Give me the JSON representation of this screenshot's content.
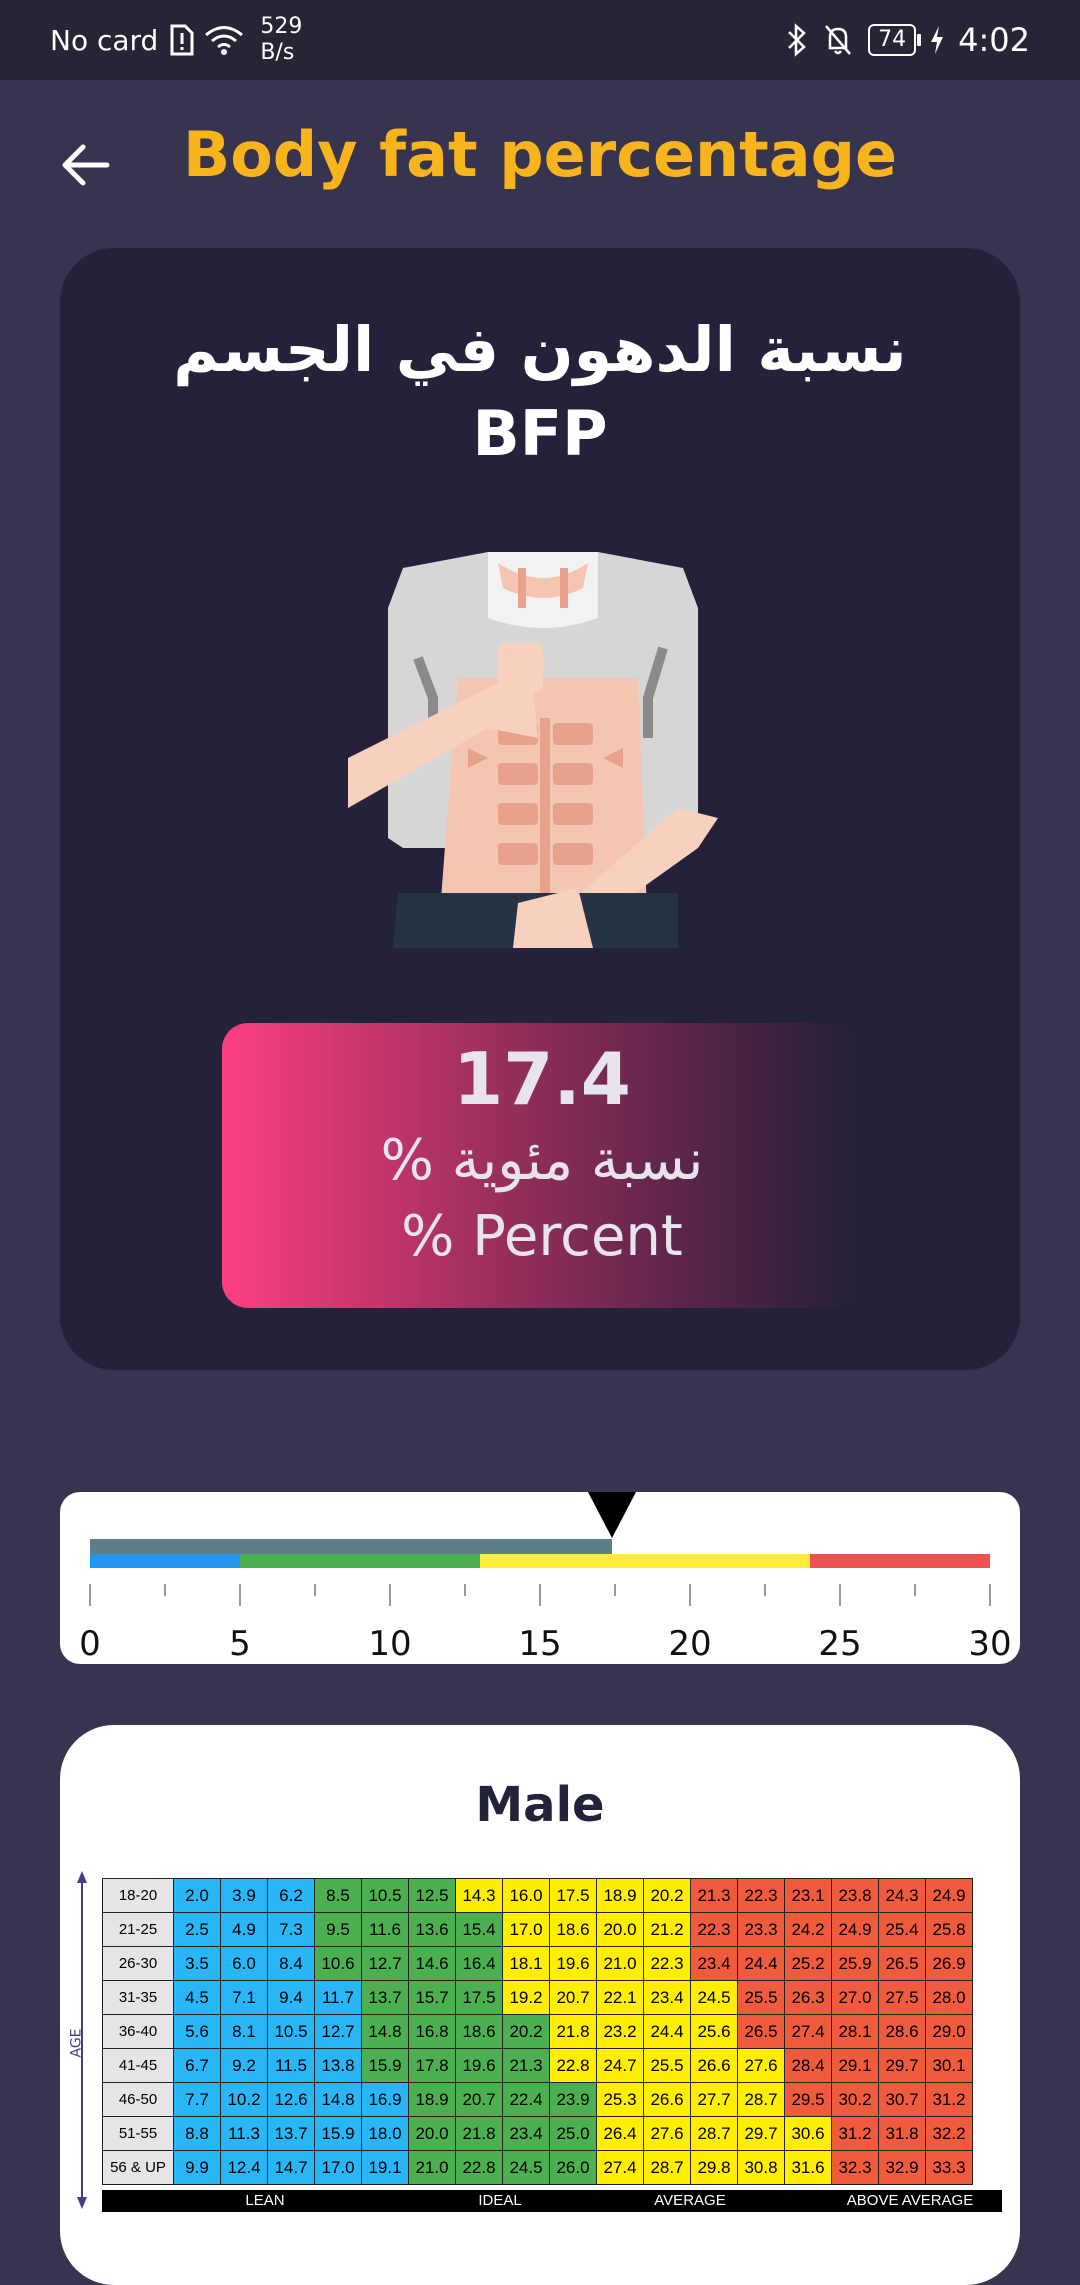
{
  "status_bar": {
    "carrier": "No card",
    "speed_value": "529",
    "speed_unit": "B/s",
    "battery": "74",
    "time": "4:02"
  },
  "header": {
    "title": "Body fat percentage",
    "back_icon": "arrow-left-icon"
  },
  "card": {
    "title_ar": "نسبة الدهون في الجسم",
    "title_en": "BFP",
    "illustration": "abs-torso-illustration"
  },
  "result": {
    "value": "17.4",
    "label_ar": "نسبة مئوية %",
    "label_en": "% Percent"
  },
  "gauge": {
    "value": 17.4,
    "min": 0,
    "max": 30,
    "ticks": [
      "0",
      "5",
      "10",
      "15",
      "20",
      "25",
      "30"
    ],
    "segments": [
      {
        "from": 0,
        "to": 5,
        "color": "#2196f3"
      },
      {
        "from": 5,
        "to": 13,
        "color": "#4caf50"
      },
      {
        "from": 13,
        "to": 24,
        "color": "#ffeb3b"
      },
      {
        "from": 24,
        "to": 30,
        "color": "#ef5350"
      }
    ],
    "fill_color": "#5d7e86"
  },
  "male_chart": {
    "title": "Male",
    "axis_label": "AGE",
    "categories": [
      "LEAN",
      "IDEAL",
      "AVERAGE",
      "ABOVE AVERAGE"
    ],
    "colors": {
      "lean": "#29b6f6",
      "ideal": "#4caf50",
      "average": "#ffee00",
      "above": "#ef5b3c"
    },
    "rows": [
      {
        "age": "18-20",
        "values": [
          "2.0",
          "3.9",
          "6.2",
          "8.5",
          "10.5",
          "12.5",
          "14.3",
          "16.0",
          "17.5",
          "18.9",
          "20.2",
          "21.3",
          "22.3",
          "23.1",
          "23.8",
          "24.3",
          "24.9"
        ],
        "bounds": [
          3,
          6,
          11
        ]
      },
      {
        "age": "21-25",
        "values": [
          "2.5",
          "4.9",
          "7.3",
          "9.5",
          "11.6",
          "13.6",
          "15.4",
          "17.0",
          "18.6",
          "20.0",
          "21.2",
          "22.3",
          "23.3",
          "24.2",
          "24.9",
          "25.4",
          "25.8"
        ],
        "bounds": [
          3,
          7,
          11
        ]
      },
      {
        "age": "26-30",
        "values": [
          "3.5",
          "6.0",
          "8.4",
          "10.6",
          "12.7",
          "14.6",
          "16.4",
          "18.1",
          "19.6",
          "21.0",
          "22.3",
          "23.4",
          "24.4",
          "25.2",
          "25.9",
          "26.5",
          "26.9"
        ],
        "bounds": [
          3,
          7,
          11
        ]
      },
      {
        "age": "31-35",
        "values": [
          "4.5",
          "7.1",
          "9.4",
          "11.7",
          "13.7",
          "15.7",
          "17.5",
          "19.2",
          "20.7",
          "22.1",
          "23.4",
          "24.5",
          "25.5",
          "26.3",
          "27.0",
          "27.5",
          "28.0"
        ],
        "bounds": [
          4,
          7,
          12
        ]
      },
      {
        "age": "36-40",
        "values": [
          "5.6",
          "8.1",
          "10.5",
          "12.7",
          "14.8",
          "16.8",
          "18.6",
          "20.2",
          "21.8",
          "23.2",
          "24.4",
          "25.6",
          "26.5",
          "27.4",
          "28.1",
          "28.6",
          "29.0"
        ],
        "bounds": [
          4,
          8,
          12
        ]
      },
      {
        "age": "41-45",
        "values": [
          "6.7",
          "9.2",
          "11.5",
          "13.8",
          "15.9",
          "17.8",
          "19.6",
          "21.3",
          "22.8",
          "24.7",
          "25.5",
          "26.6",
          "27.6",
          "28.4",
          "29.1",
          "29.7",
          "30.1"
        ],
        "bounds": [
          4,
          8,
          13
        ]
      },
      {
        "age": "46-50",
        "values": [
          "7.7",
          "10.2",
          "12.6",
          "14.8",
          "16.9",
          "18.9",
          "20.7",
          "22.4",
          "23.9",
          "25.3",
          "26.6",
          "27.7",
          "28.7",
          "29.5",
          "30.2",
          "30.7",
          "31.2"
        ],
        "bounds": [
          5,
          9,
          13
        ]
      },
      {
        "age": "51-55",
        "values": [
          "8.8",
          "11.3",
          "13.7",
          "15.9",
          "18.0",
          "20.0",
          "21.8",
          "23.4",
          "25.0",
          "26.4",
          "27.6",
          "28.7",
          "29.7",
          "30.6",
          "31.2",
          "31.8",
          "32.2"
        ],
        "bounds": [
          5,
          9,
          14
        ]
      },
      {
        "age": "56 & UP",
        "values": [
          "9.9",
          "12.4",
          "14.7",
          "17.0",
          "19.1",
          "21.0",
          "22.8",
          "24.5",
          "26.0",
          "27.4",
          "28.7",
          "29.8",
          "30.8",
          "31.6",
          "32.3",
          "32.9",
          "33.3"
        ],
        "bounds": [
          5,
          9,
          14
        ]
      }
    ]
  }
}
